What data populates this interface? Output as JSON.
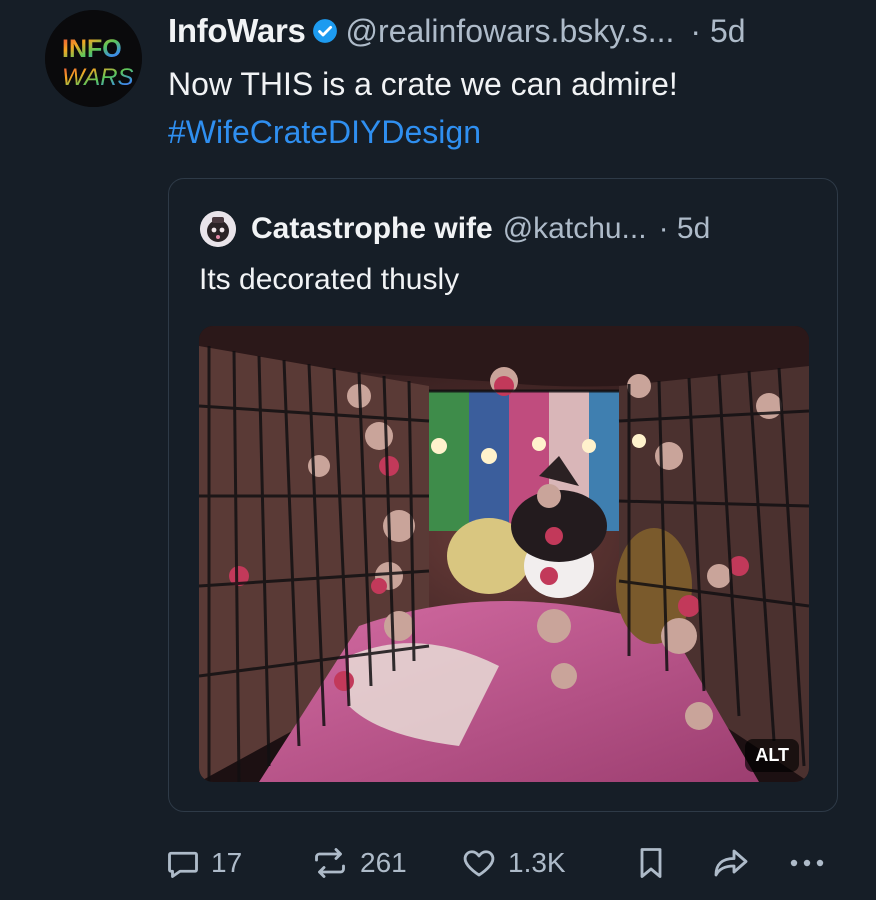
{
  "post": {
    "display_name": "InfoWars",
    "handle": "@realinfowars.bsky.s...",
    "time": "· 5d",
    "text": "Now THIS is a crate we can admire!",
    "hashtag": "#WifeCrateDIYDesign",
    "avatar_text_top": "INFO",
    "avatar_text_bottom": "WARS"
  },
  "quote": {
    "display_name": "Catastrophe wife",
    "handle": "@katchu...",
    "time": "· 5d",
    "text": "Its decorated thusly",
    "alt_label": "ALT"
  },
  "actions": {
    "reply_count": "17",
    "repost_count": "261",
    "like_count": "1.3K"
  },
  "icons": {
    "reply": "speech-bubble-icon",
    "repost": "repost-arrows-icon",
    "like": "heart-icon",
    "bookmark": "bookmark-icon",
    "share": "share-arrow-icon",
    "more": "ellipsis-icon",
    "verified": "verified-check-icon"
  },
  "colors": {
    "background": "#161e27",
    "link": "#2f8ff0",
    "muted": "#aebbc9",
    "verified": "#1d9bf0"
  }
}
